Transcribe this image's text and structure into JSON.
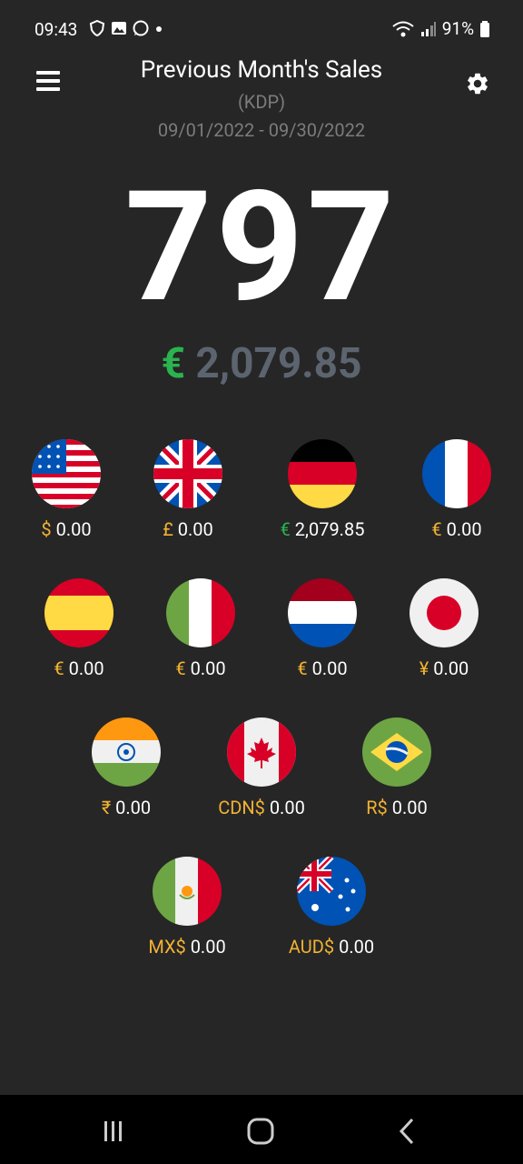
{
  "status_bar": {
    "time": "09:43",
    "battery": "91%"
  },
  "header": {
    "title": "Previous Month's Sales",
    "subtitle": "(KDP)",
    "date_range": "09/01/2022 - 09/30/2022"
  },
  "summary": {
    "units": "797",
    "currency_symbol": "€",
    "amount": "2,079.85"
  },
  "markets": [
    {
      "flag": "usa-flag-icon",
      "symbol": "$",
      "amount": "0.00"
    },
    {
      "flag": "uk-flag-icon",
      "symbol": "£",
      "amount": "0.00"
    },
    {
      "flag": "germany-flag-icon",
      "symbol": "€",
      "amount": "2,079.85"
    },
    {
      "flag": "france-flag-icon",
      "symbol": "€",
      "amount": "0.00"
    },
    {
      "flag": "spain-flag-icon",
      "symbol": "€",
      "amount": "0.00"
    },
    {
      "flag": "italy-flag-icon",
      "symbol": "€",
      "amount": "0.00"
    },
    {
      "flag": "netherlands-flag-icon",
      "symbol": "€",
      "amount": "0.00"
    },
    {
      "flag": "japan-flag-icon",
      "symbol": "¥",
      "amount": "0.00"
    },
    {
      "flag": "india-flag-icon",
      "symbol": "₹",
      "amount": "0.00"
    },
    {
      "flag": "canada-flag-icon",
      "symbol": "CDN$",
      "amount": "0.00"
    },
    {
      "flag": "brazil-flag-icon",
      "symbol": "R$",
      "amount": "0.00"
    },
    {
      "flag": "mexico-flag-icon",
      "symbol": "MX$",
      "amount": "0.00"
    },
    {
      "flag": "australia-flag-icon",
      "symbol": "AUD$",
      "amount": "0.00"
    }
  ],
  "colors": {
    "background": "#262626",
    "accent_green": "#2ab34f",
    "currency_yellow": "#f2b233",
    "muted": "#7c7c7c"
  }
}
